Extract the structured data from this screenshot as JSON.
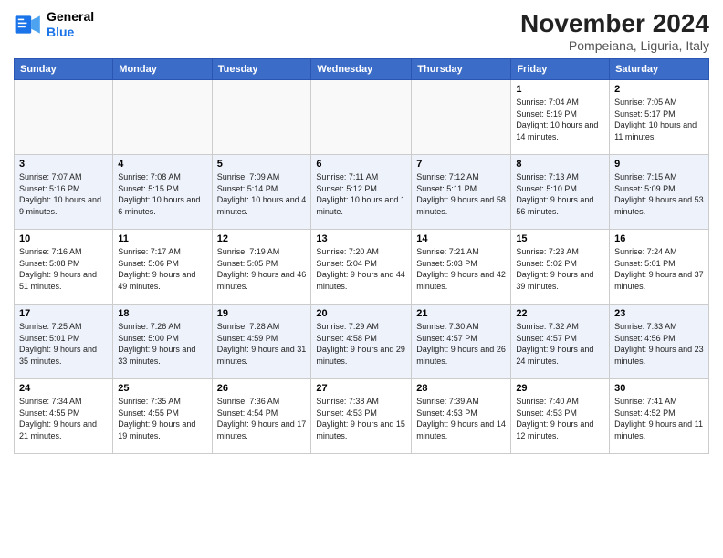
{
  "logo": {
    "line1": "General",
    "line2": "Blue"
  },
  "title": "November 2024",
  "location": "Pompeiana, Liguria, Italy",
  "weekdays": [
    "Sunday",
    "Monday",
    "Tuesday",
    "Wednesday",
    "Thursday",
    "Friday",
    "Saturday"
  ],
  "weeks": [
    [
      {
        "day": "",
        "info": ""
      },
      {
        "day": "",
        "info": ""
      },
      {
        "day": "",
        "info": ""
      },
      {
        "day": "",
        "info": ""
      },
      {
        "day": "",
        "info": ""
      },
      {
        "day": "1",
        "info": "Sunrise: 7:04 AM\nSunset: 5:19 PM\nDaylight: 10 hours and 14 minutes."
      },
      {
        "day": "2",
        "info": "Sunrise: 7:05 AM\nSunset: 5:17 PM\nDaylight: 10 hours and 11 minutes."
      }
    ],
    [
      {
        "day": "3",
        "info": "Sunrise: 7:07 AM\nSunset: 5:16 PM\nDaylight: 10 hours and 9 minutes."
      },
      {
        "day": "4",
        "info": "Sunrise: 7:08 AM\nSunset: 5:15 PM\nDaylight: 10 hours and 6 minutes."
      },
      {
        "day": "5",
        "info": "Sunrise: 7:09 AM\nSunset: 5:14 PM\nDaylight: 10 hours and 4 minutes."
      },
      {
        "day": "6",
        "info": "Sunrise: 7:11 AM\nSunset: 5:12 PM\nDaylight: 10 hours and 1 minute."
      },
      {
        "day": "7",
        "info": "Sunrise: 7:12 AM\nSunset: 5:11 PM\nDaylight: 9 hours and 58 minutes."
      },
      {
        "day": "8",
        "info": "Sunrise: 7:13 AM\nSunset: 5:10 PM\nDaylight: 9 hours and 56 minutes."
      },
      {
        "day": "9",
        "info": "Sunrise: 7:15 AM\nSunset: 5:09 PM\nDaylight: 9 hours and 53 minutes."
      }
    ],
    [
      {
        "day": "10",
        "info": "Sunrise: 7:16 AM\nSunset: 5:08 PM\nDaylight: 9 hours and 51 minutes."
      },
      {
        "day": "11",
        "info": "Sunrise: 7:17 AM\nSunset: 5:06 PM\nDaylight: 9 hours and 49 minutes."
      },
      {
        "day": "12",
        "info": "Sunrise: 7:19 AM\nSunset: 5:05 PM\nDaylight: 9 hours and 46 minutes."
      },
      {
        "day": "13",
        "info": "Sunrise: 7:20 AM\nSunset: 5:04 PM\nDaylight: 9 hours and 44 minutes."
      },
      {
        "day": "14",
        "info": "Sunrise: 7:21 AM\nSunset: 5:03 PM\nDaylight: 9 hours and 42 minutes."
      },
      {
        "day": "15",
        "info": "Sunrise: 7:23 AM\nSunset: 5:02 PM\nDaylight: 9 hours and 39 minutes."
      },
      {
        "day": "16",
        "info": "Sunrise: 7:24 AM\nSunset: 5:01 PM\nDaylight: 9 hours and 37 minutes."
      }
    ],
    [
      {
        "day": "17",
        "info": "Sunrise: 7:25 AM\nSunset: 5:01 PM\nDaylight: 9 hours and 35 minutes."
      },
      {
        "day": "18",
        "info": "Sunrise: 7:26 AM\nSunset: 5:00 PM\nDaylight: 9 hours and 33 minutes."
      },
      {
        "day": "19",
        "info": "Sunrise: 7:28 AM\nSunset: 4:59 PM\nDaylight: 9 hours and 31 minutes."
      },
      {
        "day": "20",
        "info": "Sunrise: 7:29 AM\nSunset: 4:58 PM\nDaylight: 9 hours and 29 minutes."
      },
      {
        "day": "21",
        "info": "Sunrise: 7:30 AM\nSunset: 4:57 PM\nDaylight: 9 hours and 26 minutes."
      },
      {
        "day": "22",
        "info": "Sunrise: 7:32 AM\nSunset: 4:57 PM\nDaylight: 9 hours and 24 minutes."
      },
      {
        "day": "23",
        "info": "Sunrise: 7:33 AM\nSunset: 4:56 PM\nDaylight: 9 hours and 23 minutes."
      }
    ],
    [
      {
        "day": "24",
        "info": "Sunrise: 7:34 AM\nSunset: 4:55 PM\nDaylight: 9 hours and 21 minutes."
      },
      {
        "day": "25",
        "info": "Sunrise: 7:35 AM\nSunset: 4:55 PM\nDaylight: 9 hours and 19 minutes."
      },
      {
        "day": "26",
        "info": "Sunrise: 7:36 AM\nSunset: 4:54 PM\nDaylight: 9 hours and 17 minutes."
      },
      {
        "day": "27",
        "info": "Sunrise: 7:38 AM\nSunset: 4:53 PM\nDaylight: 9 hours and 15 minutes."
      },
      {
        "day": "28",
        "info": "Sunrise: 7:39 AM\nSunset: 4:53 PM\nDaylight: 9 hours and 14 minutes."
      },
      {
        "day": "29",
        "info": "Sunrise: 7:40 AM\nSunset: 4:53 PM\nDaylight: 9 hours and 12 minutes."
      },
      {
        "day": "30",
        "info": "Sunrise: 7:41 AM\nSunset: 4:52 PM\nDaylight: 9 hours and 11 minutes."
      }
    ]
  ]
}
